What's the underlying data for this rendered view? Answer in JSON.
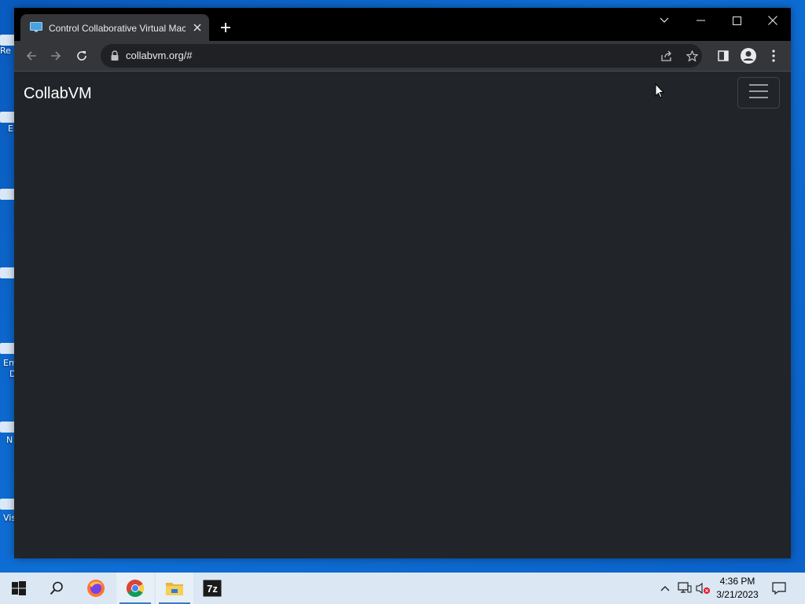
{
  "desktop": {
    "labels": [
      "Re",
      "E",
      "Em",
      "D",
      "N",
      "Vis"
    ]
  },
  "browser": {
    "tab": {
      "title": "Control Collaborative Virtual Machines",
      "favicon": "monitor-icon",
      "close_icon": "close-icon"
    },
    "new_tab_icon": "plus-icon",
    "window_controls": {
      "tab_search": "chevron-down-icon",
      "minimize": "minimize-icon",
      "maximize": "maximize-icon",
      "close": "close-icon"
    },
    "toolbar": {
      "back": "back-arrow-icon",
      "forward": "forward-arrow-icon",
      "reload": "reload-icon",
      "url": "collabvm.org/#",
      "share": "share-icon",
      "bookmark": "star-icon",
      "side_panel": "side-panel-icon",
      "profile": "profile-icon",
      "menu": "kebab-menu-icon"
    }
  },
  "page": {
    "brand": "CollabVM",
    "background_color": "#212529",
    "toggler_icon": "hamburger-icon"
  },
  "taskbar": {
    "items": [
      "start-icon",
      "search-icon",
      "firefox-icon",
      "chrome-icon",
      "file-explorer-icon",
      "7zip-icon"
    ],
    "active_item": "chrome-icon",
    "app_7zip_label": "7z",
    "tray": [
      "chevron-up-icon",
      "network-icon",
      "volume-muted-icon"
    ],
    "time": "4:36 PM",
    "date": "3/21/2023",
    "notifications_icon": "notification-icon"
  },
  "colors": {
    "titlebar": "#000000",
    "toolbar": "#35363a",
    "omnibox": "#202124",
    "taskbar": "#dbe7f3",
    "desktop": "#0b63c7"
  }
}
